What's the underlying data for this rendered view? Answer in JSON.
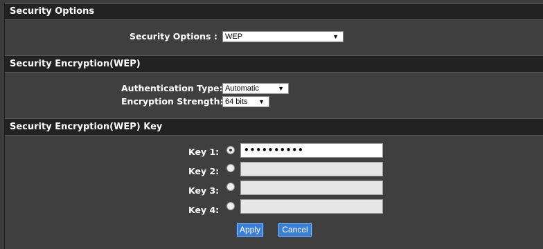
{
  "security_options": {
    "header": "Security Options",
    "label": "Security Options :",
    "selected": "WEP"
  },
  "encryption": {
    "header": "Security Encryption(WEP)",
    "auth_label": "Authentication Type:",
    "auth_selected": "Automatic",
    "strength_label": "Encryption Strength:",
    "strength_selected": "64 bits"
  },
  "keys": {
    "header": "Security Encryption(WEP) Key",
    "items": [
      {
        "label": "Key 1:",
        "value": "••••••••••",
        "selected": true
      },
      {
        "label": "Key 2:",
        "value": "",
        "selected": false
      },
      {
        "label": "Key 3:",
        "value": "",
        "selected": false
      },
      {
        "label": "Key 4:",
        "value": "",
        "selected": false
      }
    ]
  },
  "buttons": {
    "apply": "Apply",
    "cancel": "Cancel"
  },
  "colors": {
    "header_bg": "#222222",
    "body_bg": "#3f3f3f",
    "button_blue": "#3b7fd4"
  },
  "icons": {
    "dropdown_caret": "chevron-down-icon"
  }
}
